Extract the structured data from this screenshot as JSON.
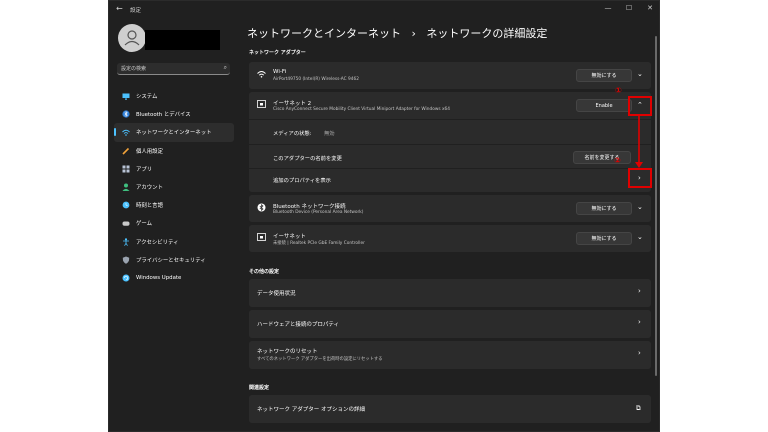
{
  "window": {
    "title": "設定",
    "back_glyph": "←",
    "controls": [
      "—",
      "☐",
      "✕"
    ]
  },
  "sidebar": {
    "search_placeholder": "設定の検索",
    "items": [
      {
        "label": "システム",
        "icon": "monitor-icon"
      },
      {
        "label": "Bluetooth とデバイス",
        "icon": "bluetooth-icon"
      },
      {
        "label": "ネットワークとインターネット",
        "icon": "wifi-icon",
        "active": true
      },
      {
        "label": "個人用設定",
        "icon": "pencil-icon"
      },
      {
        "label": "アプリ",
        "icon": "apps-icon"
      },
      {
        "label": "アカウント",
        "icon": "person-icon"
      },
      {
        "label": "時刻と言語",
        "icon": "globe-clock-icon"
      },
      {
        "label": "ゲーム",
        "icon": "gamepad-icon"
      },
      {
        "label": "アクセシビリティ",
        "icon": "accessibility-icon"
      },
      {
        "label": "プライバシーとセキュリティ",
        "icon": "shield-icon"
      },
      {
        "label": "Windows Update",
        "icon": "update-icon"
      }
    ]
  },
  "page": {
    "breadcrumb_parent": "ネットワークとインターネット",
    "breadcrumb_sep": "›",
    "breadcrumb_current": "ネットワークの詳細設定"
  },
  "adapters_section": {
    "label": "ネットワーク アダプター",
    "wifi": {
      "title": "Wi-Fi",
      "sub": "AirPort49750 (Intel(R) Wireless-AC 9462",
      "button": "無効にする"
    },
    "ethernet2": {
      "title": "イーサネット 2",
      "sub": "Cisco AnyConnect Secure Mobility Client Virtual Miniport Adapter for Windows x64",
      "button": "Enable",
      "media_label": "メディアの状態:",
      "media_value": "無効",
      "rename_label": "このアダプターの名前を変更",
      "rename_button": "名前を変更する",
      "props_label": "追加のプロパティを表示"
    },
    "bluetooth": {
      "title": "Bluetooth ネットワーク接続",
      "sub": "Bluetooth Device (Personal Area Network)",
      "button": "無効にする"
    },
    "ethernet": {
      "title": "イーサネット",
      "sub": "未接続 | Realtek PCIe GbE Family Controller",
      "button": "無効にする"
    }
  },
  "other_section": {
    "label": "その他の設定",
    "items": [
      {
        "title": "データ使用状況"
      },
      {
        "title": "ハードウェアと接続のプロパティ"
      },
      {
        "title": "ネットワークのリセット",
        "sub": "すべてのネットワーク アダプターを出荷時の設定にリセットする"
      }
    ]
  },
  "related_section": {
    "label": "関連設定",
    "items": [
      {
        "title": "ネットワーク アダプター オプションの詳細"
      }
    ]
  },
  "annotations": {
    "marker1": "①",
    "marker2": "②"
  },
  "colors": {
    "accent": "#4cc2ff",
    "annotation": "#e00000",
    "window_bg": "#202020",
    "card_bg": "#2b2b2b"
  }
}
